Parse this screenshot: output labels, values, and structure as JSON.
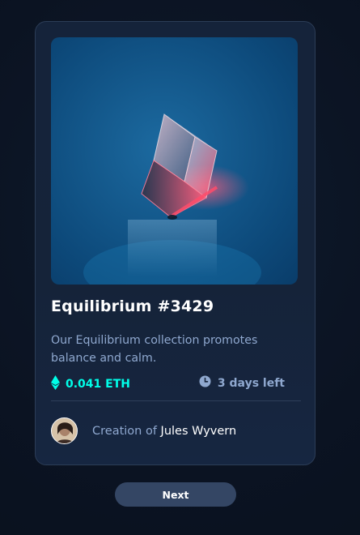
{
  "card": {
    "title": "Equilibrium #3429",
    "description": "Our Equilibrium collection promotes balance and calm.",
    "price": "0.041 ETH",
    "time_left": "3 days left",
    "creator_prefix": "Creation of ",
    "creator_name": "Jules Wyvern"
  },
  "navigation": {
    "next_label": "Next"
  },
  "icons": {
    "price": "ethereum-icon",
    "time": "clock-icon"
  },
  "colors": {
    "background": "#0d1525",
    "card_background": "#15233a",
    "accent_cyan": "#00ffe9",
    "soft_blue": "#8fa8cf",
    "button_background": "#344664"
  }
}
